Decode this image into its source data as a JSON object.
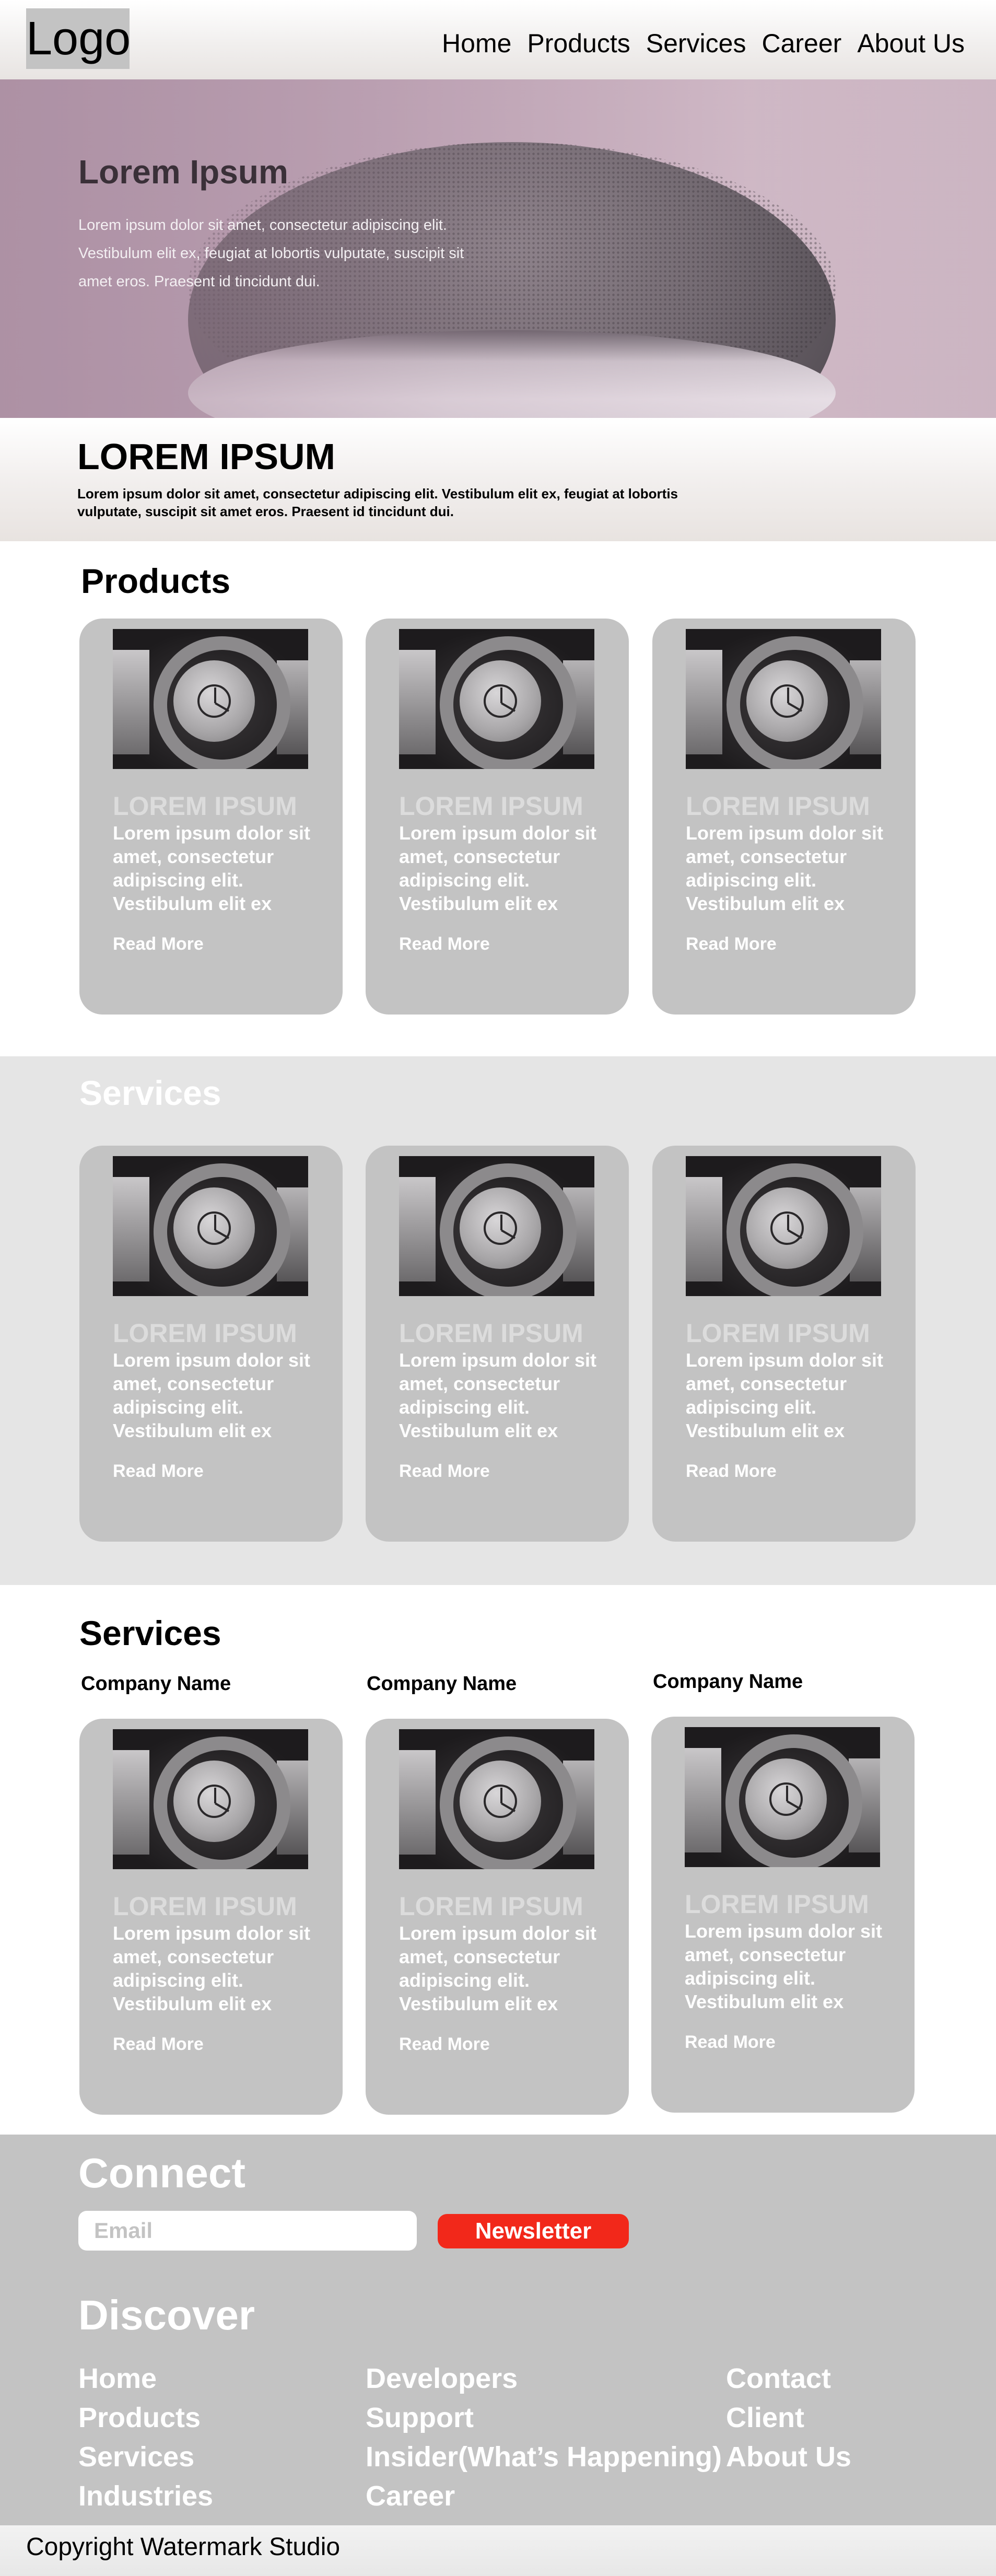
{
  "header": {
    "logo": "Logo",
    "nav": [
      "Home",
      "Products",
      "Services",
      "Career",
      "About Us"
    ]
  },
  "hero": {
    "title": "Lorem Ipsum",
    "text": "Lorem ipsum dolor sit amet, consectetur adipiscing elit. Vestibulum elit ex, feugiat at lobortis vulputate, suscipit sit amet eros. Praesent id tincidunt dui."
  },
  "banner": {
    "title": "LOREM IPSUM",
    "text": "Lorem ipsum dolor sit amet, consectetur adipiscing elit. Vestibulum elit ex, feugiat at lobortis vulputate, suscipit sit amet eros. Praesent id tincidunt dui."
  },
  "products": {
    "title": "Products",
    "cards": [
      {
        "title": "LOREM IPSUM",
        "text": "Lorem ipsum dolor sit amet, consectetur adipiscing elit. Vestibulum elit ex",
        "link": "Read More"
      },
      {
        "title": "LOREM IPSUM",
        "text": "Lorem ipsum dolor sit amet, consectetur adipiscing elit. Vestibulum elit ex",
        "link": "Read More"
      },
      {
        "title": "LOREM IPSUM",
        "text": "Lorem ipsum dolor sit amet, consectetur adipiscing elit. Vestibulum elit ex",
        "link": "Read More"
      }
    ]
  },
  "services": {
    "title": "Services",
    "cards": [
      {
        "title": "LOREM IPSUM",
        "text": "Lorem ipsum dolor sit amet, consectetur adipiscing elit. Vestibulum elit ex",
        "link": "Read More"
      },
      {
        "title": "LOREM IPSUM",
        "text": "Lorem ipsum dolor sit amet, consectetur adipiscing elit. Vestibulum elit ex",
        "link": "Read More"
      },
      {
        "title": "LOREM IPSUM",
        "text": "Lorem ipsum dolor sit amet, consectetur adipiscing elit. Vestibulum elit ex",
        "link": "Read More"
      }
    ]
  },
  "services2": {
    "title": "Services",
    "companies": [
      "Company Name",
      "Company Name",
      "Company Name"
    ],
    "cards": [
      {
        "title": "LOREM IPSUM",
        "text": "Lorem ipsum dolor sit amet, consectetur adipiscing elit. Vestibulum elit ex",
        "link": "Read More"
      },
      {
        "title": "LOREM IPSUM",
        "text": "Lorem ipsum dolor sit amet, consectetur adipiscing elit. Vestibulum elit ex",
        "link": "Read More"
      },
      {
        "title": "LOREM IPSUM",
        "text": "Lorem ipsum dolor sit amet, consectetur adipiscing elit. Vestibulum elit ex",
        "link": "Read More"
      }
    ]
  },
  "footer": {
    "connect_title": "Connect",
    "email_placeholder": "Email",
    "newsletter_label": "Newsletter",
    "discover_title": "Discover",
    "col1": [
      "Home",
      "Products",
      "Services",
      "Industries"
    ],
    "col2": [
      "Developers",
      "Support",
      "Insider(What’s Happening)",
      "Career"
    ],
    "col3": [
      "Contact",
      "Client",
      "About Us"
    ],
    "copyright": "Copyright Watermark Studio"
  },
  "colors": {
    "card_gray": "#c3c3c3",
    "band_gray": "#e5e5e5",
    "newsletter_red": "#f2281a"
  }
}
